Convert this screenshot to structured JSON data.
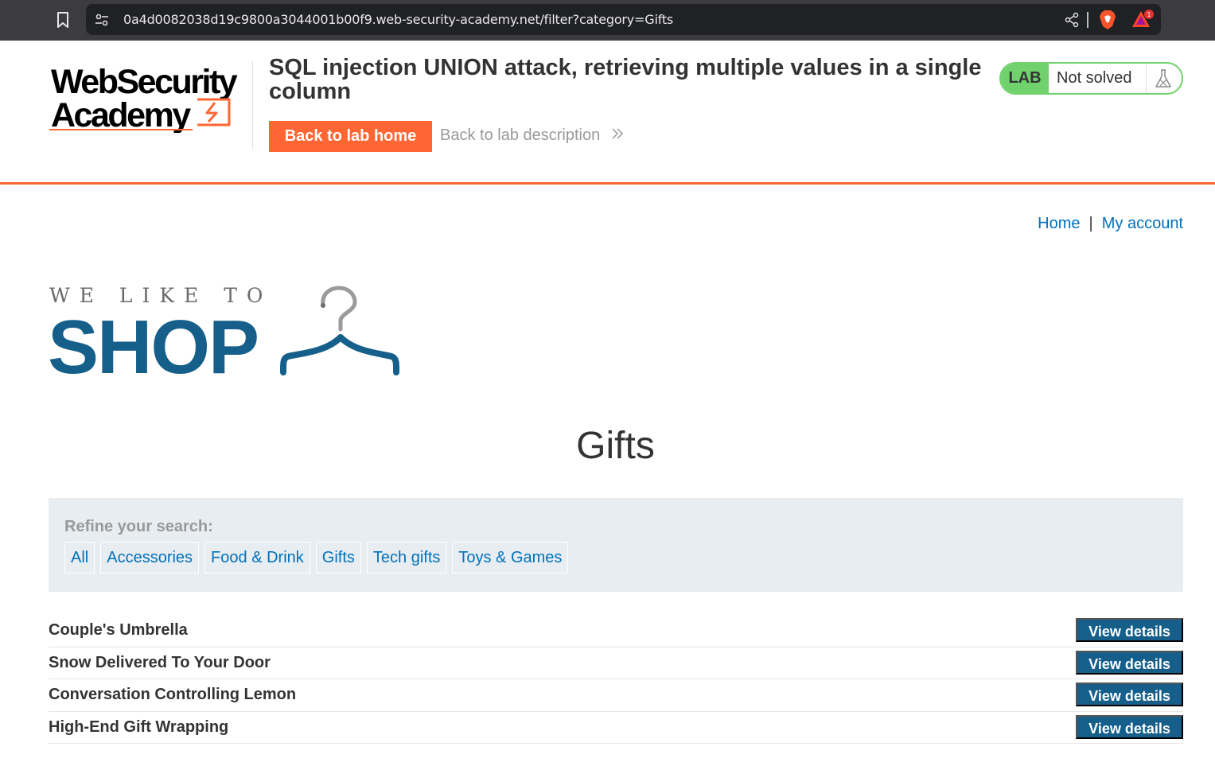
{
  "browser": {
    "url": "0a4d0082038d19c9800a3044001b00f9.web-security-academy.net/filter?category=Gifts",
    "rewards_count": "1"
  },
  "lab_header": {
    "logo_line1": "WebSecurity",
    "logo_line2": "Academy",
    "title": "SQL injection UNION attack, retrieving multiple values in a single column",
    "back_home_label": "Back to lab home",
    "back_desc_label": "Back to lab description",
    "status_badge": "LAB",
    "status_text": "Not solved"
  },
  "top_nav": {
    "home_label": "Home",
    "separator": "|",
    "account_label": "My account"
  },
  "shop_logo": {
    "tagline": "WE LIKE TO",
    "word": "SHOP"
  },
  "page": {
    "heading": "Gifts"
  },
  "filter": {
    "label": "Refine your search:",
    "categories": [
      "All",
      "Accessories",
      "Food & Drink",
      "Gifts",
      "Tech gifts",
      "Toys & Games"
    ]
  },
  "products": {
    "button_label": "View details",
    "items": [
      {
        "name": "Couple's Umbrella"
      },
      {
        "name": "Snow Delivered To Your Door"
      },
      {
        "name": "Conversation Controlling Lemon"
      },
      {
        "name": "High-End Gift Wrapping"
      }
    ]
  },
  "colors": {
    "brand_orange": "#ff6633",
    "link_blue": "#0071bc",
    "shop_blue": "#155f8a",
    "lab_green": "#70d16d",
    "filter_bg": "#e8edf1"
  }
}
